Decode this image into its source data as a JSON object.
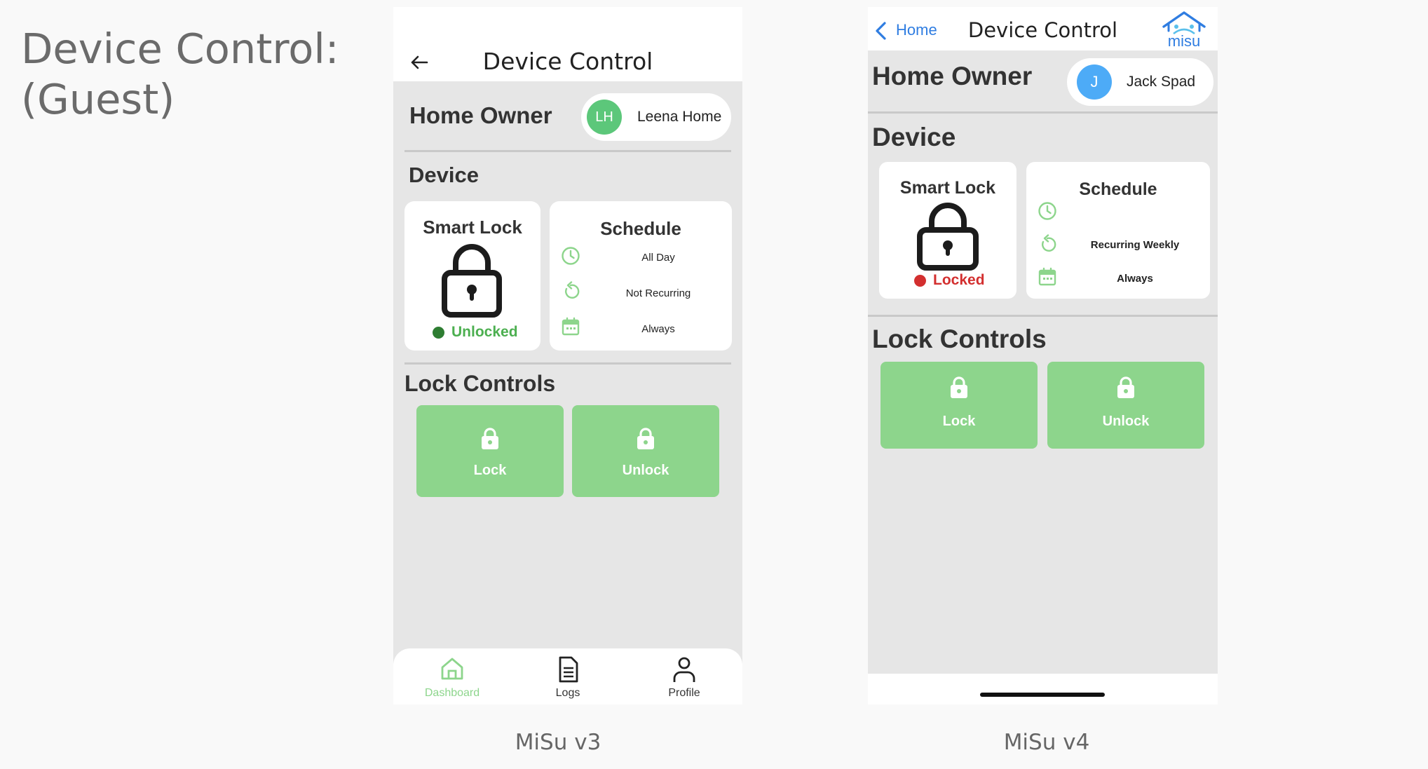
{
  "slide": {
    "title_line1": "Device Control:",
    "title_line2": "(Guest)",
    "caption_v3": "MiSu v3",
    "caption_v4": "MiSu v4"
  },
  "v3": {
    "header": {
      "title": "Device Control",
      "back_icon": "arrow-left-icon"
    },
    "owner": {
      "label": "Home Owner",
      "initials": "LH",
      "name": "Leena Home",
      "avatar_color": "#5cc77a"
    },
    "device_label": "Device",
    "lock_card": {
      "title": "Smart Lock",
      "status": "Unlocked",
      "status_color": "#4caf50"
    },
    "schedule": {
      "title": "Schedule",
      "time": "All Day",
      "recurrence": "Not Recurring",
      "dates": "Always"
    },
    "controls_label": "Lock Controls",
    "buttons": {
      "lock": "Lock",
      "unlock": "Unlock",
      "color": "#8dd58c"
    },
    "nav": {
      "dashboard": "Dashboard",
      "logs": "Logs",
      "profile": "Profile",
      "active_color": "#8dd58c"
    }
  },
  "v4": {
    "header": {
      "back_label": "Home",
      "title": "Device Control",
      "logo_text": "misu"
    },
    "owner": {
      "label": "Home Owner",
      "initials": "J",
      "name": "Jack Spad",
      "avatar_color": "#4dabf7"
    },
    "device_label": "Device",
    "lock_card": {
      "title": "Smart Lock",
      "status": "Locked",
      "status_color": "#d32f2f"
    },
    "schedule": {
      "title": "Schedule",
      "time": "",
      "recurrence": "Recurring Weekly",
      "dates": "Always"
    },
    "controls_label": "Lock Controls",
    "buttons": {
      "lock": "Lock",
      "unlock": "Unlock",
      "color": "#8dd58c"
    }
  }
}
